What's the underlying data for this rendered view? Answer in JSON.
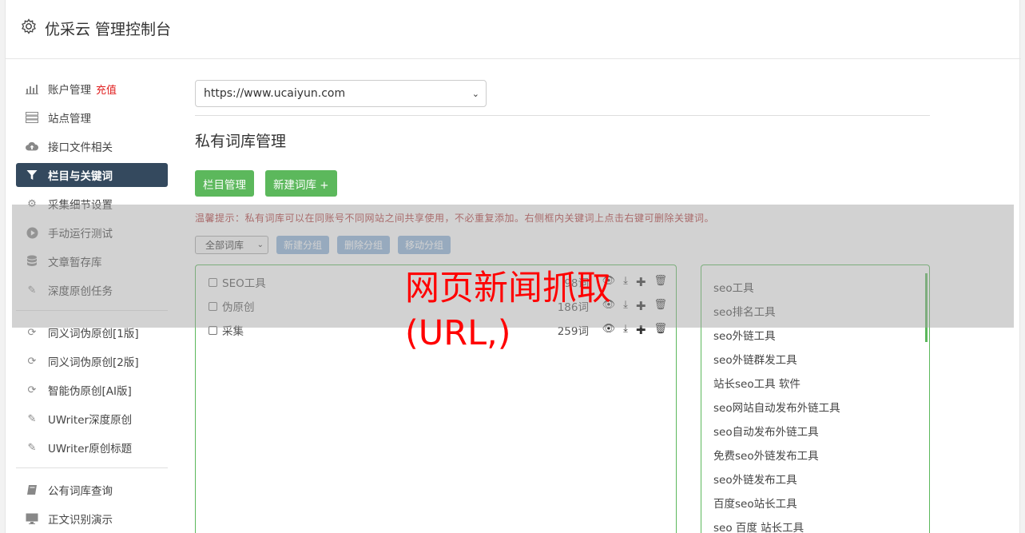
{
  "header": {
    "title": "优采云 管理控制台"
  },
  "sidebar": {
    "items": [
      {
        "icon": "bar-chart-icon",
        "glyph": "📊",
        "label": "账户管理",
        "extra": "充值"
      },
      {
        "icon": "server-icon",
        "glyph": "☰",
        "label": "站点管理"
      },
      {
        "icon": "cloud-upload-icon",
        "glyph": "☁",
        "label": "接口文件相关"
      },
      {
        "icon": "filter-icon",
        "glyph": "▼",
        "label": "栏目与关键词"
      },
      {
        "icon": "cogs-icon",
        "glyph": "⚙",
        "label": "采集细节设置"
      },
      {
        "icon": "play-circle-icon",
        "glyph": "▶",
        "label": "手动运行测试"
      },
      {
        "icon": "database-icon",
        "glyph": "≡",
        "label": "文章暂存库"
      },
      {
        "icon": "edit-icon",
        "glyph": "✎",
        "label": "深度原创任务"
      },
      {
        "icon": "refresh-icon",
        "glyph": "⟳",
        "label": "同义词伪原创[1版]"
      },
      {
        "icon": "refresh-icon",
        "glyph": "⟳",
        "label": "同义词伪原创[2版]"
      },
      {
        "icon": "refresh-icon",
        "glyph": "⟳",
        "label": "智能伪原创[AI版]"
      },
      {
        "icon": "edit-icon",
        "glyph": "✎",
        "label": "UWriter深度原创"
      },
      {
        "icon": "edit-icon",
        "glyph": "✎",
        "label": "UWriter原创标题"
      },
      {
        "icon": "book-icon",
        "glyph": "▮",
        "label": "公有词库查询"
      },
      {
        "icon": "monitor-icon",
        "glyph": "▭",
        "label": "正文识别演示"
      }
    ]
  },
  "main": {
    "site_select": "https://www.ucaiyun.com",
    "page_title": "私有词库管理",
    "btn_category": "栏目管理",
    "btn_new_lib": "新建词库 +",
    "tip": "温馨提示：私有词库可以在同账号不同网站之间共享使用，不必重复添加。右侧框内关键词上点击右键可删除关键词。",
    "group_select": "全部词库",
    "btn_new_group": "新建分组",
    "btn_del_group": "删除分组",
    "btn_move_group": "移动分组",
    "libraries": [
      {
        "name": "SEO工具",
        "count": "98词"
      },
      {
        "name": "伪原创",
        "count": "186词"
      },
      {
        "name": "采集",
        "count": "259词"
      }
    ],
    "keywords": [
      "seo工具",
      "seo排名工具",
      "seo外链工具",
      "seo外链群发工具",
      "站长seo工具 软件",
      "seo网站自动发布外链工具",
      "seo自动发布外链工具",
      "免费seo外链发布工具",
      "seo外链发布工具",
      "百度seo站长工具",
      "seo 百度 站长工具"
    ]
  },
  "watermark": "网页新闻抓取(URL,)",
  "colors": {
    "active_nav": "#34495e",
    "green": "#5cb85c",
    "blue_btn": "#8fb3d9",
    "watermark": "#ff0000"
  }
}
